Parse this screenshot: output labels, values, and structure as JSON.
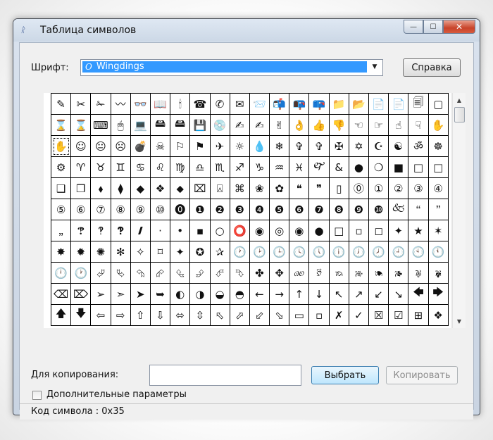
{
  "window": {
    "title": "Таблица символов",
    "icon_glyph": "ᚱ",
    "minimize_glyph": "—",
    "maximize_glyph": "☐",
    "close_glyph": "✕"
  },
  "font_picker": {
    "label": "Шрифт:",
    "selected_value": "Wingdings",
    "font_icon_glyph": "O",
    "dropdown_glyph": "▼"
  },
  "help_button": {
    "label": "Справка"
  },
  "character_grid": {
    "rows": 11,
    "columns": 20,
    "selected_index": 40,
    "cells": [
      "✎",
      "✂",
      "✁",
      "〰",
      "👓",
      "📖",
      "🕯",
      "☎",
      "✆",
      "✉",
      "📨",
      "📬",
      "📭",
      "📪",
      "📁",
      "📂",
      "📄",
      "📄",
      "🗐",
      "▢",
      "⌛",
      "⌛",
      "⌨",
      "🖱",
      "💻",
      "🖴",
      "🖴",
      "💾",
      "💿",
      "✍",
      "✍",
      "✌",
      "👌",
      "👍",
      "👎",
      "☜",
      "☞",
      "☝",
      "☟",
      "✋",
      "✋",
      "☺",
      "😐",
      "☹",
      "💣",
      "☠",
      "⚐",
      "⚑",
      "✈",
      "☼",
      "💧",
      "❄",
      "✞",
      "✞",
      "✠",
      "✡",
      "☪",
      "☯",
      "ॐ",
      "☸",
      "⚙",
      "♈",
      "♉",
      "♊",
      "♋",
      "♌",
      "♍",
      "♎",
      "♏",
      "♐",
      "♑",
      "♒",
      "♓",
      "🙰",
      "&",
      "●",
      "❍",
      "■",
      "□",
      "□",
      "❑",
      "❒",
      "⬧",
      "⧫",
      "◆",
      "❖",
      "⬥",
      "⌧",
      "⍓",
      "⌘",
      "❀",
      "✿",
      "❝",
      "❞",
      "▯",
      "⓪",
      "①",
      "②",
      "③",
      "④",
      "⑤",
      "⑥",
      "⑦",
      "⑧",
      "⑨",
      "⑩",
      "⓿",
      "❶",
      "❷",
      "❸",
      "❹",
      "❺",
      "❻",
      "❼",
      "❽",
      "❾",
      "❿",
      "🙵",
      "🙶",
      "🙷",
      "🙸",
      "🙹",
      "🙺",
      "🙻",
      "🙼",
      "·",
      "•",
      "▪",
      "○",
      "⭕",
      "◉",
      "◎",
      "◉",
      "●",
      "□",
      "▫",
      "◻",
      "✦",
      "★",
      "✶",
      "✸",
      "✹",
      "✺",
      "✻",
      "✧",
      "⌑",
      "✦",
      "✪",
      "✰",
      "🕐",
      "🕑",
      "🕒",
      "🕓",
      "🕔",
      "🕕",
      "🕖",
      "🕗",
      "🕘",
      "🕙",
      "🕚",
      "🕛",
      "🕐",
      "⮰",
      "⮱",
      "⮲",
      "⮳",
      "⮴",
      "⮵",
      "⮶",
      "⮷",
      "✤",
      "✥",
      "🙐",
      "🙑",
      "🙒",
      "🙓",
      "🙔",
      "🙕",
      "🙖",
      "🙗",
      "⌫",
      "⌦",
      "➢",
      "➣",
      "➤",
      "➥",
      "◐",
      "◑",
      "◒",
      "◓",
      "←",
      "→",
      "↑",
      "↓",
      "↖",
      "↗",
      "↙",
      "↘",
      "🡄",
      "🡆",
      "🡅",
      "🡇",
      "⇦",
      "⇨",
      "⇧",
      "⇩",
      "⬄",
      "⇳",
      "⬁",
      "⬀",
      "⬃",
      "⬂",
      "▭",
      "▫",
      "✗",
      "✓",
      "☒",
      "☑",
      "⊞",
      "❖"
    ]
  },
  "copy_row": {
    "label": "Для копирования:",
    "value": "",
    "select_button": "Выбрать",
    "copy_button": "Копировать"
  },
  "advanced": {
    "label": "Дополнительные параметры",
    "checked": false
  },
  "status": {
    "text": "Код символа : 0x35"
  },
  "scrollbar": {
    "up_glyph": "▲",
    "down_glyph": "▼"
  }
}
